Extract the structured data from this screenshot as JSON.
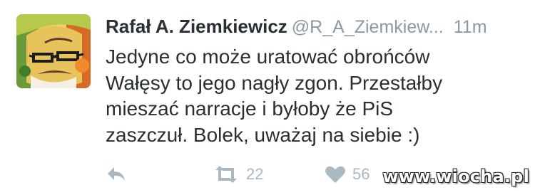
{
  "tweet": {
    "author_name": "Rafał A. Ziemkiewicz",
    "handle": "@R_A_Ziemkiew...",
    "time": "11m",
    "text_lines": [
      "Jedyne co może uratować obrońców",
      "Wałęsy to jego nagły zgon. Przestałby",
      "mieszać narracje i byłoby że PiS",
      "zaszczuł. Bolek, uważaj na siebie :)"
    ],
    "retweet_count": "22",
    "like_count": "56"
  },
  "icons": {
    "reply": "reply-icon",
    "retweet": "retweet-icon",
    "like": "heart-icon"
  },
  "colors": {
    "text": "#292f33",
    "muted": "#8899a6",
    "action": "#aab8c2"
  },
  "watermark": "www.wiocha.pl"
}
